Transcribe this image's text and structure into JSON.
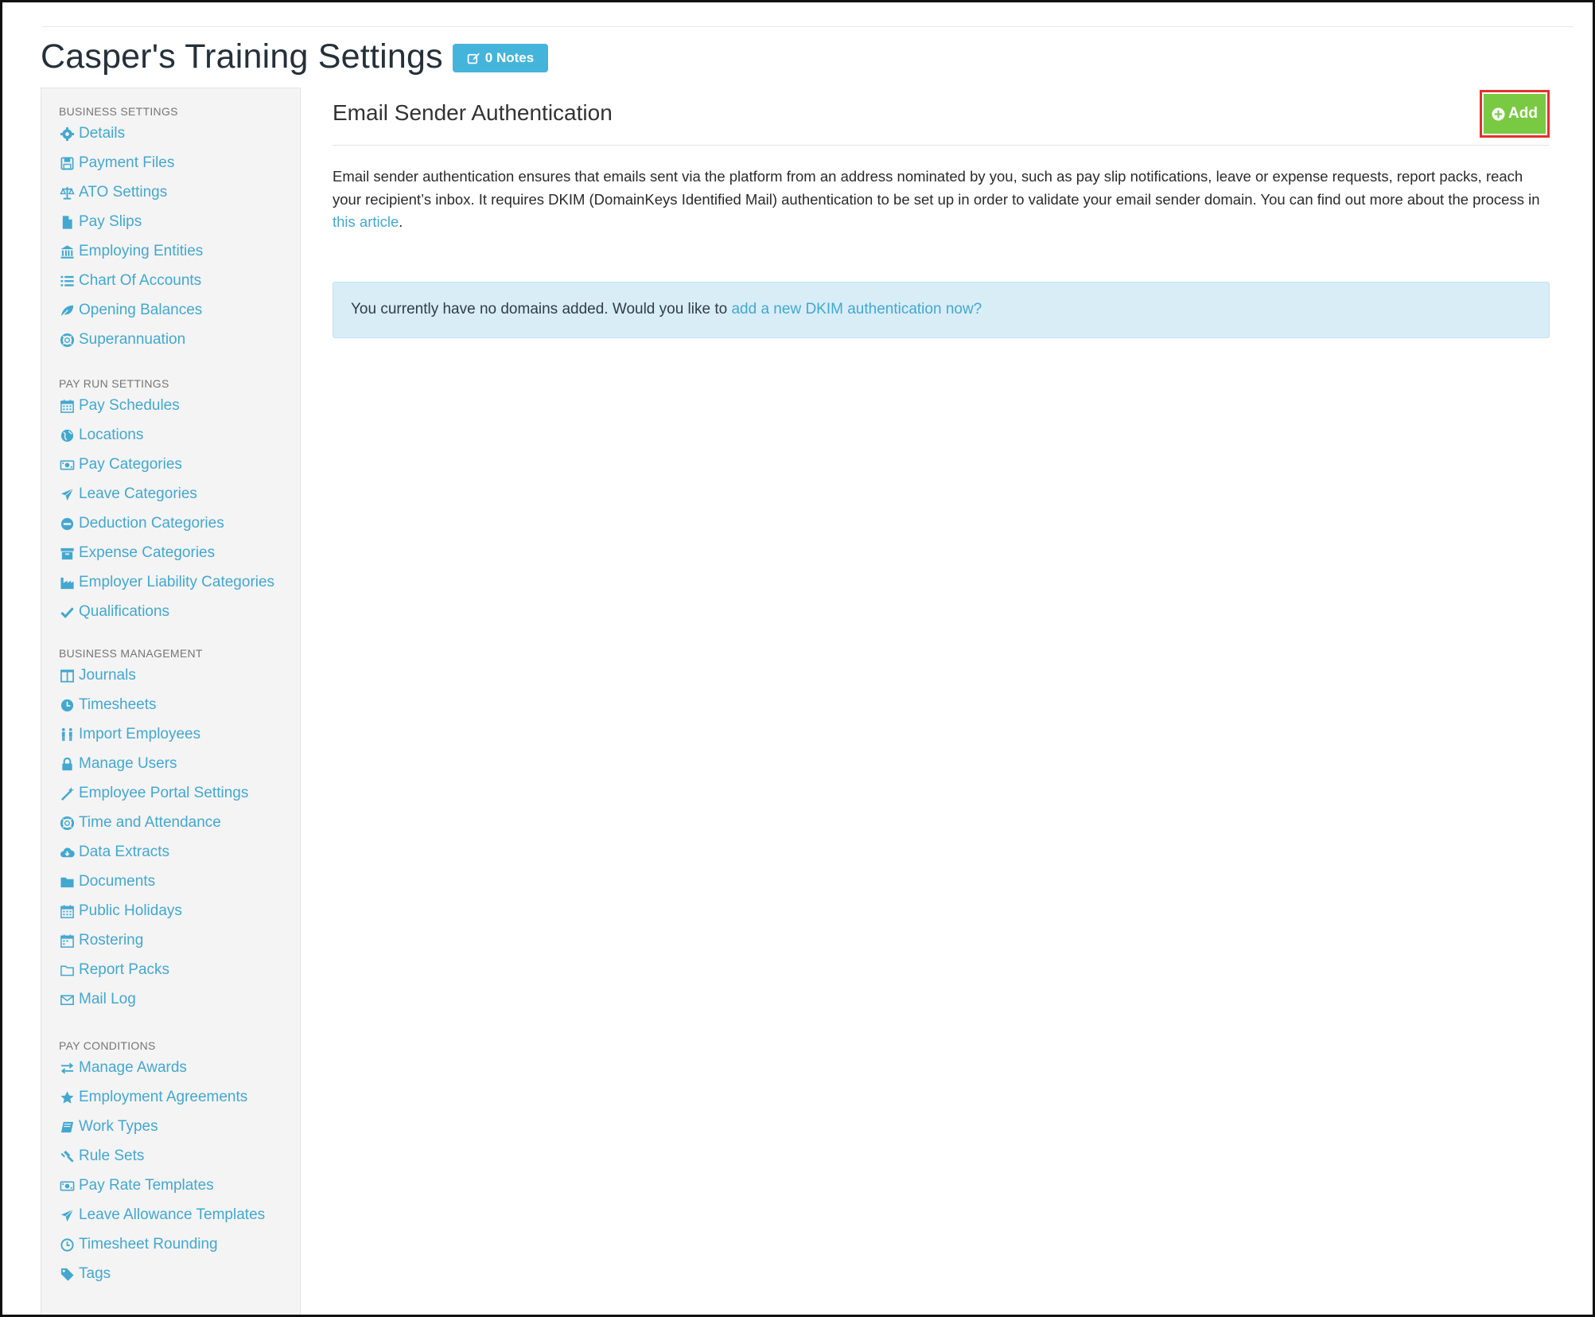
{
  "page": {
    "title": "Casper's Training Settings",
    "notes_label": "0 Notes"
  },
  "sidebar": {
    "sections": [
      {
        "title": "BUSINESS SETTINGS",
        "items": [
          {
            "label": "Details",
            "icon": "gear-icon"
          },
          {
            "label": "Payment Files",
            "icon": "floppy-icon"
          },
          {
            "label": "ATO Settings",
            "icon": "scale-icon"
          },
          {
            "label": "Pay Slips",
            "icon": "file-icon"
          },
          {
            "label": "Employing Entities",
            "icon": "bank-icon"
          },
          {
            "label": "Chart Of Accounts",
            "icon": "list-icon"
          },
          {
            "label": "Opening Balances",
            "icon": "leaf-icon"
          },
          {
            "label": "Superannuation",
            "icon": "lifebuoy-icon"
          }
        ]
      },
      {
        "title": "PAY RUN SETTINGS",
        "items": [
          {
            "label": "Pay Schedules",
            "icon": "calendar-icon"
          },
          {
            "label": "Locations",
            "icon": "globe-icon"
          },
          {
            "label": "Pay Categories",
            "icon": "money-icon"
          },
          {
            "label": "Leave Categories",
            "icon": "plane-icon"
          },
          {
            "label": "Deduction Categories",
            "icon": "minus-circle-icon"
          },
          {
            "label": "Expense Categories",
            "icon": "archive-icon"
          },
          {
            "label": "Employer Liability Categories",
            "icon": "industry-icon"
          },
          {
            "label": "Qualifications",
            "icon": "check-icon"
          }
        ]
      },
      {
        "title": "BUSINESS MANAGEMENT",
        "items": [
          {
            "label": "Journals",
            "icon": "columns-icon"
          },
          {
            "label": "Timesheets",
            "icon": "clock-icon"
          },
          {
            "label": "Import Employees",
            "icon": "people-icon"
          },
          {
            "label": "Manage Users",
            "icon": "lock-icon"
          },
          {
            "label": "Employee Portal Settings",
            "icon": "magic-wand-icon"
          },
          {
            "label": "Time and Attendance",
            "icon": "lifebuoy-icon"
          },
          {
            "label": "Data Extracts",
            "icon": "cloud-download-icon"
          },
          {
            "label": "Documents",
            "icon": "folder-icon"
          },
          {
            "label": "Public Holidays",
            "icon": "calendar-icon"
          },
          {
            "label": "Rostering",
            "icon": "calendar-grid-icon"
          },
          {
            "label": "Report Packs",
            "icon": "folder-outline-icon"
          },
          {
            "label": "Mail Log",
            "icon": "envelope-icon"
          }
        ]
      },
      {
        "title": "PAY CONDITIONS",
        "items": [
          {
            "label": "Manage Awards",
            "icon": "exchange-icon"
          },
          {
            "label": "Employment Agreements",
            "icon": "star-icon"
          },
          {
            "label": "Work Types",
            "icon": "book-icon"
          },
          {
            "label": "Rule Sets",
            "icon": "gavel-icon"
          },
          {
            "label": "Pay Rate Templates",
            "icon": "money-icon"
          },
          {
            "label": "Leave Allowance Templates",
            "icon": "plane-icon"
          },
          {
            "label": "Timesheet Rounding",
            "icon": "clock-outline-icon"
          },
          {
            "label": "Tags",
            "icon": "tag-icon"
          }
        ]
      }
    ]
  },
  "main": {
    "section_title": "Email Sender Authentication",
    "add_label": "Add",
    "description": "Email sender authentication ensures that emails sent via the platform from an address nominated by you, such as pay slip notifications, leave or expense requests, report packs, reach your recipient’s inbox. It requires DKIM (DomainKeys Identified Mail) authentication to be set up in order to validate your email sender domain. You can find out more about the process in ",
    "description_link": "this article",
    "description_end": ".",
    "alert_text": "You currently have no domains added. Would you like to ",
    "alert_link": "add a new DKIM authentication now?"
  },
  "colors": {
    "link": "#43a8cf",
    "notes_button": "#45b4da",
    "add_button": "#7ac943",
    "highlight_outline": "#e2312c",
    "alert_bg": "#d9edf7"
  }
}
